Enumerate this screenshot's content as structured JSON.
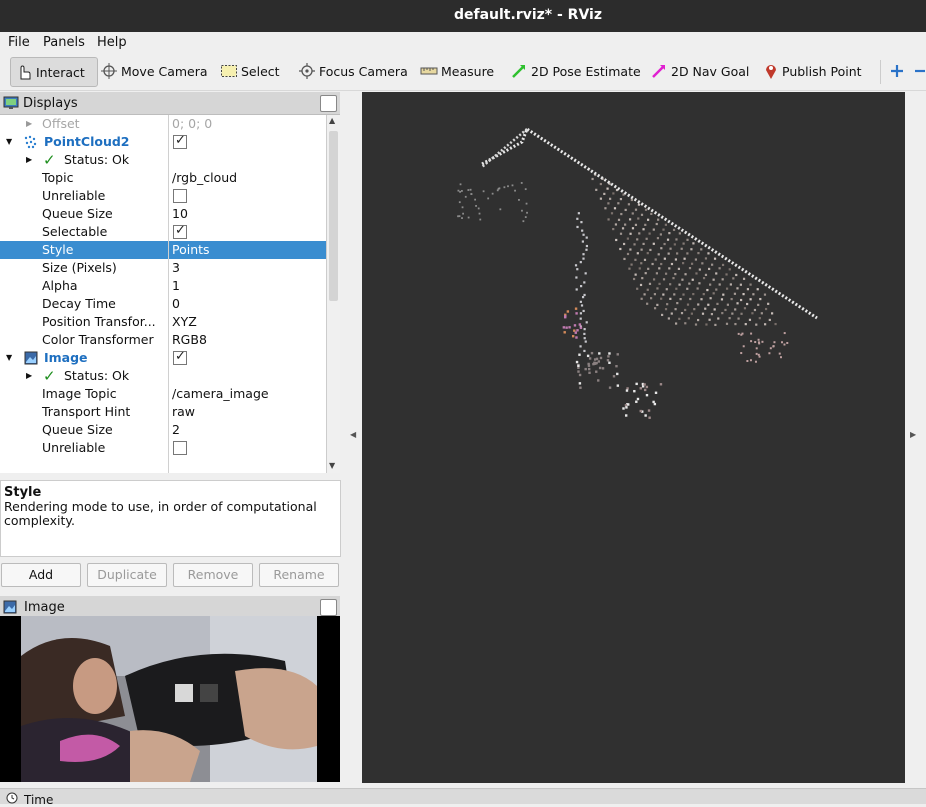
{
  "window": {
    "title": "default.rviz* - RViz"
  },
  "menu": {
    "file": "File",
    "panels": "Panels",
    "help": "Help"
  },
  "toolbar": {
    "interact": "Interact",
    "move_camera": "Move Camera",
    "select": "Select",
    "focus_camera": "Focus Camera",
    "measure": "Measure",
    "pose_estimate": "2D Pose Estimate",
    "nav_goal": "2D Nav Goal",
    "publish_point": "Publish Point"
  },
  "displays_panel": {
    "title": "Displays",
    "rows": [
      {
        "key": "Offset",
        "value": "0; 0; 0"
      },
      {
        "key": "PointCloud2"
      },
      {
        "key": "Status: Ok"
      },
      {
        "key": "Topic",
        "value": "/rgb_cloud"
      },
      {
        "key": "Unreliable"
      },
      {
        "key": "Queue Size",
        "value": "10"
      },
      {
        "key": "Selectable"
      },
      {
        "key": "Style",
        "value": "Points"
      },
      {
        "key": "Size (Pixels)",
        "value": "3"
      },
      {
        "key": "Alpha",
        "value": "1"
      },
      {
        "key": "Decay Time",
        "value": "0"
      },
      {
        "key": "Position Transfor...",
        "value": "XYZ"
      },
      {
        "key": "Color Transformer",
        "value": "RGB8"
      },
      {
        "key": "Image"
      },
      {
        "key": "Status: Ok"
      },
      {
        "key": "Image Topic",
        "value": "/camera_image"
      },
      {
        "key": "Transport Hint",
        "value": "raw"
      },
      {
        "key": "Queue Size",
        "value": "2"
      },
      {
        "key": "Unreliable"
      }
    ]
  },
  "description": {
    "title": "Style",
    "text": "Rendering mode to use, in order of computational complexity."
  },
  "buttons": {
    "add": "Add",
    "duplicate": "Duplicate",
    "remove": "Remove",
    "rename": "Rename"
  },
  "image_panel": {
    "title": "Image"
  },
  "time_panel": {
    "title": "Time"
  },
  "colors": {
    "selection": "#3a8dd0",
    "display_label": "#1e6fc0",
    "viewport": "#303030",
    "status_ok": "#1f8f1f"
  }
}
